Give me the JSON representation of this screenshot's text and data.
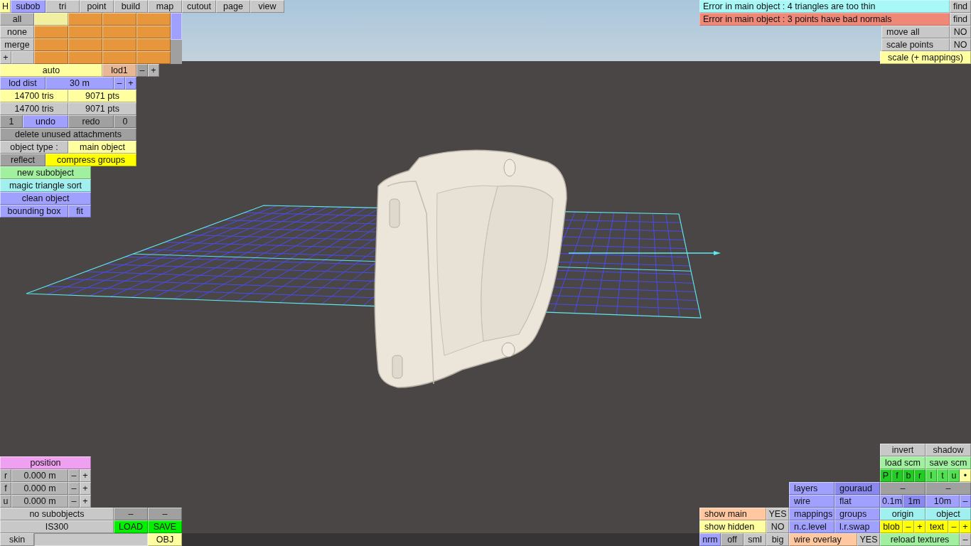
{
  "top_left_panel": {
    "rows": [
      {
        "items": [
          {
            "text": "H",
            "color": "#ffffa0"
          },
          {
            "text": "subob",
            "selected": true
          },
          {
            "text": "tri",
            "selected": false
          },
          {
            "text": "point",
            "selected": false
          },
          {
            "text": "build",
            "selected": false
          },
          {
            "text": "map",
            "selected": false
          },
          {
            "text": "cutout",
            "selected": false
          },
          {
            "text": "page",
            "selected": false
          },
          {
            "text": "view",
            "selected": false
          }
        ]
      },
      {
        "items": [
          {
            "text": "all",
            "color": "#b4b4b4"
          },
          {
            "color": "#f0f0a0"
          },
          {
            "color": "#e8963c"
          },
          {
            "color": "#e8963c"
          },
          {
            "color": "#e8963c"
          }
        ]
      },
      {
        "items": [
          {
            "text": "none",
            "color": "#c8c8c8"
          },
          {
            "color": "#e8963c"
          },
          {
            "color": "#e8963c"
          },
          {
            "color": "#e8963c"
          },
          {
            "color": "#e8963c"
          }
        ]
      },
      {
        "items": [
          {
            "text": "merge",
            "color": "#c8c8c8"
          },
          {
            "color": "#e8963c"
          },
          {
            "color": "#e8963c"
          },
          {
            "color": "#e8963c"
          },
          {
            "color": "#e8963c"
          }
        ]
      },
      {
        "items": [
          {
            "text": "+",
            "color": "#c8c8c8"
          },
          {
            "color": "#c8c8c8"
          },
          {
            "color": "#e8963c"
          },
          {
            "color": "#e8963c"
          },
          {
            "color": "#e8963c"
          },
          {
            "color": "#e8963c"
          }
        ]
      },
      {
        "items": [
          {
            "text": "auto",
            "color": "#ffffa0"
          },
          {
            "text": "lod1",
            "color": "#e8b896"
          },
          {
            "text": "–",
            "color": "#a0a0a0"
          },
          {
            "text": "+",
            "color": "#b4b4b4"
          }
        ]
      },
      {
        "items": [
          {
            "text": "lod dist",
            "color": "#a0a0ff"
          },
          {
            "text": "30 m",
            "color": "#a0a0ff"
          },
          {
            "text": "–",
            "color": "#a0a0ff"
          },
          {
            "text": "+",
            "color": "#a0a0ff"
          }
        ]
      },
      {
        "items": [
          {
            "text": "14700 tris",
            "color": "#ffffa0"
          },
          {
            "text": "9071 pts",
            "color": "#ffffa0"
          }
        ]
      },
      {
        "items": [
          {
            "text": "14700 tris",
            "color": "#c8c8c8"
          },
          {
            "text": "9071 pts",
            "color": "#c8c8c8"
          }
        ]
      },
      {
        "items": [
          {
            "text": "1",
            "color": "#a0a0a0"
          },
          {
            "text": "undo",
            "color": "#a0a0ff"
          },
          {
            "text": "redo",
            "color": "#a0a0a0"
          },
          {
            "text": "0",
            "color": "#a0a0a0"
          }
        ]
      },
      {
        "items": [
          {
            "text": "delete unused attachments",
            "color": "#a0a0a0"
          }
        ]
      },
      {
        "items": [
          {
            "text": "object type :",
            "color": "#c8c8c8"
          },
          {
            "text": "main object",
            "color": "#ffffa0"
          }
        ]
      },
      {
        "items": [
          {
            "text": "reflect",
            "color": "#a0a0a0"
          },
          {
            "text": "compress groups",
            "color": "#ffff00"
          }
        ]
      },
      {
        "items": [
          {
            "text": "new subobject",
            "color": "#a0f0a0"
          }
        ]
      },
      {
        "items": [
          {
            "text": "magic triangle sort",
            "color": "#a0f0f0"
          }
        ]
      },
      {
        "items": [
          {
            "text": "clean object",
            "color": "#a0a0ff"
          }
        ]
      },
      {
        "items": [
          {
            "text": "bounding box",
            "color": "#a0a0ff"
          },
          {
            "text": "fit",
            "color": "#a0a0ff"
          }
        ]
      }
    ]
  },
  "top_right_panel": {
    "rows": [
      {
        "items": [
          {
            "kind": "message",
            "text": "Error in main object : 4 triangles are too thin",
            "color": "#a8f8f8"
          },
          {
            "text": "find",
            "color": "#c8c8c8"
          }
        ]
      },
      {
        "items": [
          {
            "kind": "message",
            "text": "Error in main object : 3 points have bad normals",
            "color": "#f08878"
          },
          {
            "text": "find",
            "color": "#c8c8c8"
          }
        ]
      },
      {
        "items": [
          {
            "kind": "toggle",
            "text": "move all",
            "color": "#c8c8c8"
          },
          {
            "text": "NO",
            "color": "#c8c8c8"
          }
        ]
      },
      {
        "items": [
          {
            "kind": "toggle",
            "text": "scale points",
            "color": "#c8c8c8"
          },
          {
            "text": "NO",
            "color": "#c8c8c8"
          }
        ]
      },
      {
        "items": [
          {
            "text": "scale (+ mappings)",
            "color": "#ffffa0"
          }
        ]
      }
    ]
  },
  "bottom_right_panel": {
    "rows": [
      {
        "items": [
          {
            "text": "invert",
            "color": "#c8c8c8"
          },
          {
            "text": "shadow",
            "color": "#c8c8c8"
          }
        ]
      },
      {
        "items": [
          {
            "text": "load scm",
            "color": "#a0f0a0"
          },
          {
            "text": "save scm",
            "color": "#a0f0a0"
          }
        ]
      },
      {
        "items": [
          {
            "text": "P",
            "color": "#22cc22"
          },
          {
            "text": "f",
            "color": "#22cc22"
          },
          {
            "text": "b",
            "color": "#22cc22"
          },
          {
            "text": "r",
            "color": "#22cc22"
          },
          {
            "text": "l",
            "color": "#50e050"
          },
          {
            "text": "t",
            "color": "#50e050"
          },
          {
            "text": "u",
            "color": "#50e050"
          },
          {
            "text": "•",
            "color": "#ffffa0"
          }
        ]
      },
      {
        "items": [
          {
            "kind": "toggle",
            "text": "layers",
            "color": "#a0a0ff"
          },
          {
            "kind": "toggle",
            "text": "gouraud",
            "color": "#8888ee"
          },
          {
            "text": "–",
            "color": "#a0a0a0"
          },
          {
            "text": "–",
            "color": "#a0a0a0"
          }
        ]
      },
      {
        "items": [
          {
            "kind": "toggle",
            "text": "wire",
            "color": "#a0a0ff"
          },
          {
            "kind": "toggle",
            "text": "flat",
            "color": "#a0a0ff"
          },
          {
            "text": "0.1m",
            "color": "#a0a0ff"
          },
          {
            "text": "1m",
            "color": "#8888ee"
          },
          {
            "text": "10m",
            "color": "#a0a0ff"
          },
          {
            "text": "–",
            "color": "#a0a0ff"
          }
        ]
      },
      {
        "items": [
          {
            "kind": "toggle",
            "text": "show main",
            "color": "#ffc8a0"
          },
          {
            "text": "YES",
            "color": "#c8c8c8"
          },
          {
            "kind": "toggle",
            "text": "mappings",
            "color": "#a0a0ff"
          },
          {
            "kind": "toggle",
            "text": "groups",
            "color": "#a0a0ff"
          },
          {
            "text": "origin",
            "color": "#a0f0f0"
          },
          {
            "text": "object",
            "color": "#a0f0f0"
          }
        ]
      },
      {
        "items": [
          {
            "kind": "toggle",
            "text": "show hidden",
            "color": "#ffffa0"
          },
          {
            "text": "NO",
            "color": "#c8c8c8"
          },
          {
            "kind": "toggle",
            "text": "n.c.level",
            "color": "#a0a0ff"
          },
          {
            "kind": "toggle",
            "text": "l.r.swap",
            "color": "#a0a0ff"
          },
          {
            "text": "blob",
            "color": "#ffff00"
          },
          {
            "text": "–",
            "color": "#ffff00"
          },
          {
            "text": "+",
            "color": "#ffff00"
          },
          {
            "text": "text",
            "color": "#ffff00"
          },
          {
            "text": "–",
            "color": "#ffff00"
          },
          {
            "text": "+",
            "color": "#ffff00"
          }
        ]
      },
      {
        "items": [
          {
            "text": "nrm",
            "color": "#a0a0ff"
          },
          {
            "text": "off",
            "color": "#b4b4b4"
          },
          {
            "text": "sml",
            "color": "#c8c8c8"
          },
          {
            "text": "big",
            "color": "#c8c8c8"
          },
          {
            "kind": "toggle",
            "text": "wire overlay",
            "color": "#ffc8a0"
          },
          {
            "text": "YES",
            "color": "#c8c8c8"
          },
          {
            "text": "reload textures",
            "color": "#a0f0a0"
          },
          {
            "text": "–",
            "color": "#c8c8c8"
          }
        ]
      }
    ]
  },
  "bottom_left_panel": {
    "rows": [
      {
        "items": [
          {
            "text": "position",
            "color": "#f0a0f0"
          }
        ]
      },
      {
        "items": [
          {
            "text": "r",
            "color": "#b4b4b4"
          },
          {
            "text": "0.000 m",
            "color": "#b4b4b4"
          },
          {
            "text": "–",
            "color": "#b4b4b4"
          },
          {
            "text": "+",
            "color": "#c8c8c8"
          }
        ]
      },
      {
        "items": [
          {
            "text": "f",
            "color": "#b4b4b4"
          },
          {
            "text": "0.000 m",
            "color": "#b4b4b4"
          },
          {
            "text": "–",
            "color": "#b4b4b4"
          },
          {
            "text": "+",
            "color": "#c8c8c8"
          }
        ]
      },
      {
        "items": [
          {
            "text": "u",
            "color": "#b4b4b4"
          },
          {
            "text": "0.000 m",
            "color": "#b4b4b4"
          },
          {
            "text": "–",
            "color": "#b4b4b4"
          },
          {
            "text": "+",
            "color": "#c8c8c8"
          }
        ]
      },
      {
        "items": [
          {
            "text": "no subobjects",
            "color": "#c8c8c8"
          },
          {
            "text": "–",
            "color": "#a0a0a0"
          },
          {
            "text": "–",
            "color": "#a0a0a0"
          }
        ]
      },
      {
        "items": [
          {
            "text": "IS300",
            "color": "#c8c8c8"
          },
          {
            "text": "LOAD",
            "color": "#00f000"
          },
          {
            "text": "SAVE",
            "color": "#00f000"
          }
        ]
      },
      {
        "items": [
          {
            "text": "skin",
            "color": "#c8c8c8"
          },
          {
            "kind": "field",
            "color": "#c8c8c8"
          },
          {
            "text": "OBJ",
            "color": "#ffffa0"
          }
        ]
      }
    ]
  }
}
